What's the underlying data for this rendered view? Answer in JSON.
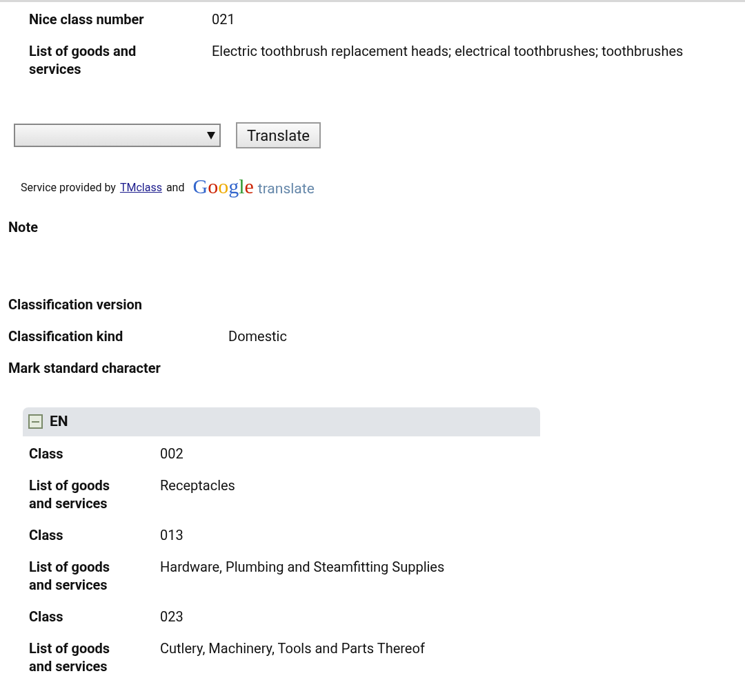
{
  "top_fields": [
    {
      "label": "Nice class number",
      "value": "021"
    },
    {
      "label": "List of goods and services",
      "value": "Electric toothbrush replacement heads; electrical toothbrushes; toothbrushes"
    }
  ],
  "translate": {
    "button": "Translate",
    "credit_prefix": "Service provided by",
    "credit_link": "TMclass",
    "credit_and": "and",
    "logo_word": "Google",
    "logo_suffix": "translate"
  },
  "fields": [
    {
      "label": "Note"
    },
    {
      "label": "Classification version"
    },
    {
      "label": "Classification kind",
      "value": "Domestic"
    },
    {
      "label": "Mark standard character"
    }
  ],
  "section": {
    "title": "EN",
    "expanded": true,
    "rows": [
      {
        "label": "Class",
        "value": "002"
      },
      {
        "label": "List of goods and services",
        "value": "Receptacles"
      },
      {
        "label": "Class",
        "value": "013"
      },
      {
        "label": "List of goods and services",
        "value": "Hardware, Plumbing and Steamfitting Supplies"
      },
      {
        "label": "Class",
        "value": "023"
      },
      {
        "label": "List of goods and services",
        "value": "Cutlery, Machinery, Tools and Parts Thereof"
      }
    ]
  }
}
